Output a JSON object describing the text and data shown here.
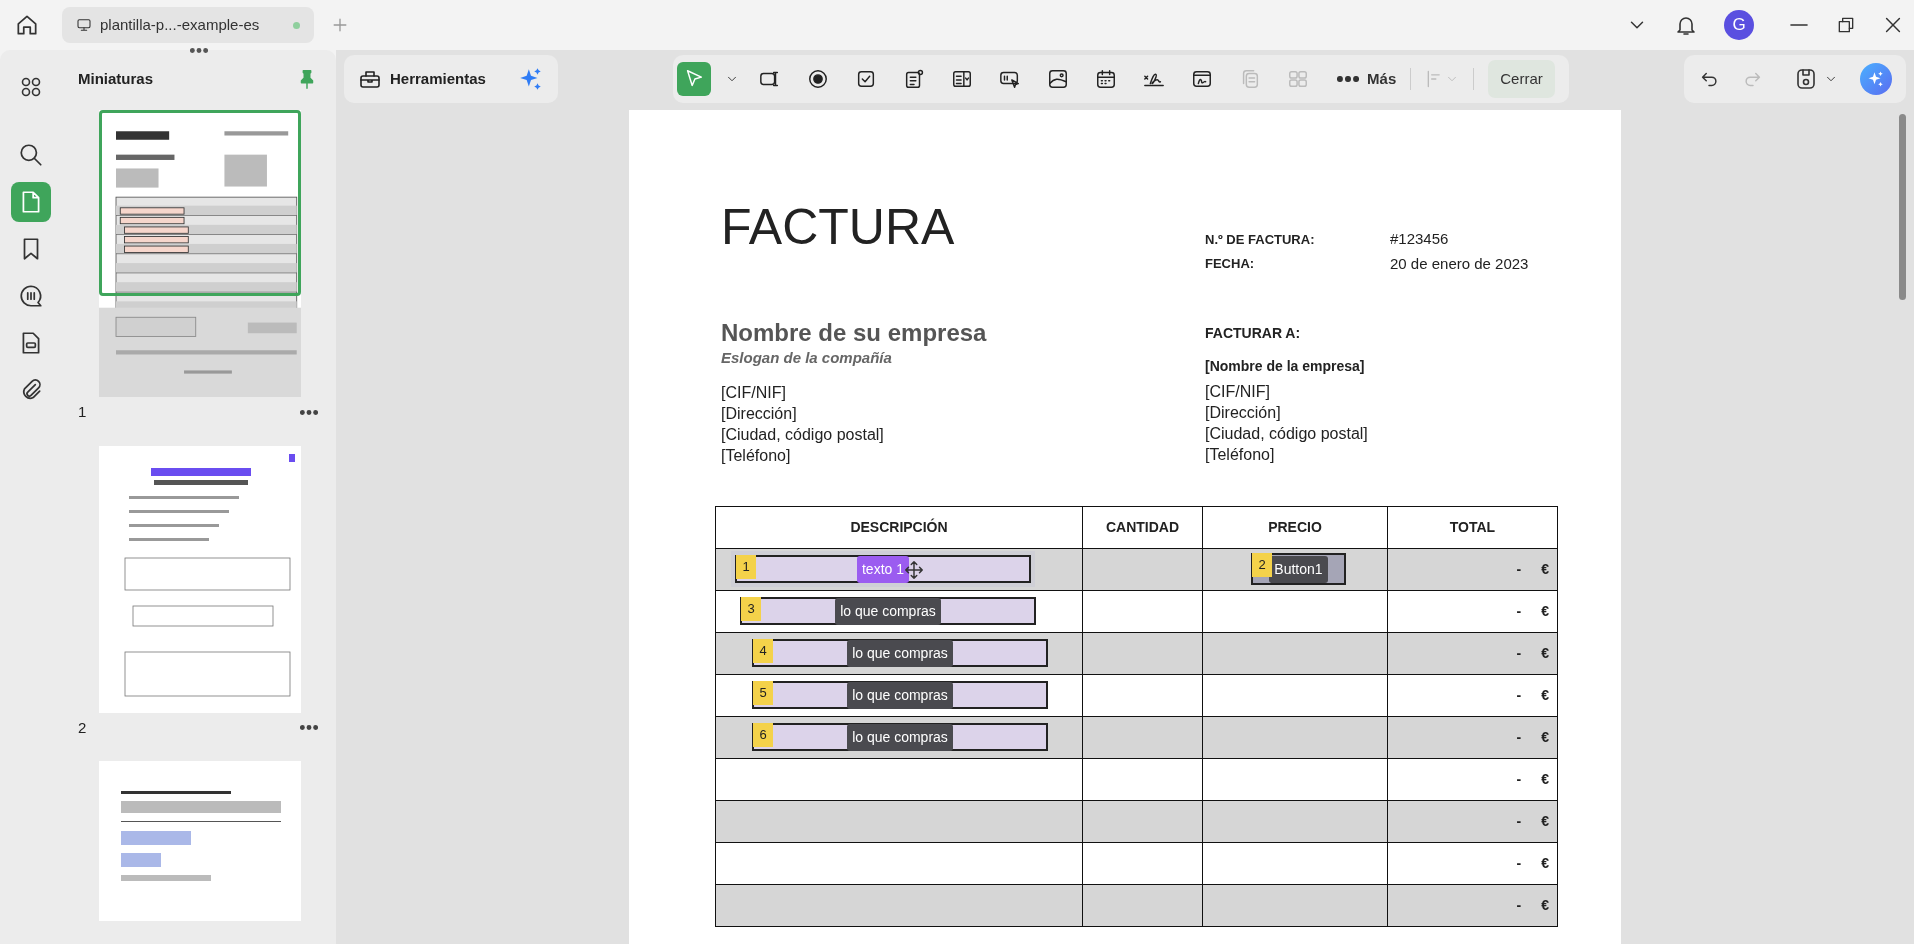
{
  "tab": {
    "title": "plantilla-p...-example-es"
  },
  "user": {
    "initial": "G"
  },
  "sidebar": {
    "title": "Miniaturas",
    "nav": [
      {
        "kind": "search",
        "selected": false
      },
      {
        "kind": "pages",
        "selected": true
      },
      {
        "kind": "bookmarks",
        "selected": false
      },
      {
        "kind": "comments",
        "selected": false
      },
      {
        "kind": "forms",
        "selected": false
      },
      {
        "kind": "attachments",
        "selected": false
      }
    ]
  },
  "thumbnails": [
    {
      "kind": "invoice",
      "page": "1",
      "selected": true
    },
    {
      "kind": "survey",
      "page": "2",
      "selected": false
    },
    {
      "kind": "letter",
      "selected": false
    }
  ],
  "tools_panel": {
    "title": "Herramientas"
  },
  "toolbar": {
    "tools": [
      {
        "kind": "select",
        "selected": true,
        "disabled": false
      },
      {
        "kind": "text-field",
        "selected": false,
        "disabled": false
      },
      {
        "kind": "radio",
        "selected": false,
        "disabled": false
      },
      {
        "kind": "checkbox",
        "selected": false,
        "disabled": false
      },
      {
        "kind": "list-box",
        "selected": false,
        "disabled": false
      },
      {
        "kind": "combo-box",
        "selected": false,
        "disabled": false
      },
      {
        "kind": "button",
        "selected": false,
        "disabled": false
      },
      {
        "kind": "image",
        "selected": false,
        "disabled": false
      },
      {
        "kind": "date",
        "selected": false,
        "disabled": false
      },
      {
        "kind": "signature",
        "selected": false,
        "disabled": false
      },
      {
        "kind": "sign-field",
        "selected": false,
        "disabled": false
      },
      {
        "kind": "duplicate",
        "selected": false,
        "disabled": true
      },
      {
        "kind": "grid",
        "selected": false,
        "disabled": true
      }
    ],
    "more": "Más",
    "align_disabled": true,
    "close": "Cerrar"
  },
  "history": {
    "undo_disabled": false,
    "redo_disabled": true
  },
  "invoice": {
    "title": "FACTURA",
    "meta": [
      {
        "label": "N.º DE FACTURA:",
        "value": "#123456"
      },
      {
        "label": "FECHA:",
        "value": "20 de enero de 2023"
      }
    ],
    "company": {
      "name": "Nombre de su empresa",
      "slogan": "Eslogan de la compañía",
      "lines": [
        "[CIF/NIF]",
        "[Dirección]",
        "[Ciudad, código postal]",
        "[Teléfono]"
      ]
    },
    "bill_to": {
      "heading": "FACTURAR A:",
      "name": "[Nombre de la empresa]",
      "lines": [
        "[CIF/NIF]",
        "[Dirección]",
        "[Ciudad, código postal]",
        "[Teléfono]"
      ]
    },
    "table": {
      "columns": [
        "DESCRIPCIÓN",
        "CANTIDAD",
        "PRECIO",
        "TOTAL"
      ],
      "rows": [
        {
          "total": "-",
          "currency": "€",
          "fields": [
            {
              "number": "1",
              "label": "texto 1",
              "kind": "text",
              "selected": true
            },
            {
              "number": "2",
              "label": "Button1",
              "kind": "button",
              "selected": false
            }
          ]
        },
        {
          "total": "-",
          "currency": "€",
          "fields": [
            {
              "number": "3",
              "label": "lo que compras",
              "kind": "text",
              "selected": false
            }
          ]
        },
        {
          "total": "-",
          "currency": "€",
          "fields": [
            {
              "number": "4",
              "label": "lo que compras",
              "kind": "text",
              "selected": false
            }
          ]
        },
        {
          "total": "-",
          "currency": "€",
          "fields": [
            {
              "number": "5",
              "label": "lo que compras",
              "kind": "text",
              "selected": false
            }
          ]
        },
        {
          "total": "-",
          "currency": "€",
          "fields": [
            {
              "number": "6",
              "label": "lo que compras",
              "kind": "text",
              "selected": false
            }
          ]
        },
        {
          "total": "-",
          "currency": "€"
        },
        {
          "total": "-",
          "currency": "€"
        },
        {
          "total": "-",
          "currency": "€"
        },
        {
          "total": "-",
          "currency": "€"
        }
      ]
    }
  }
}
